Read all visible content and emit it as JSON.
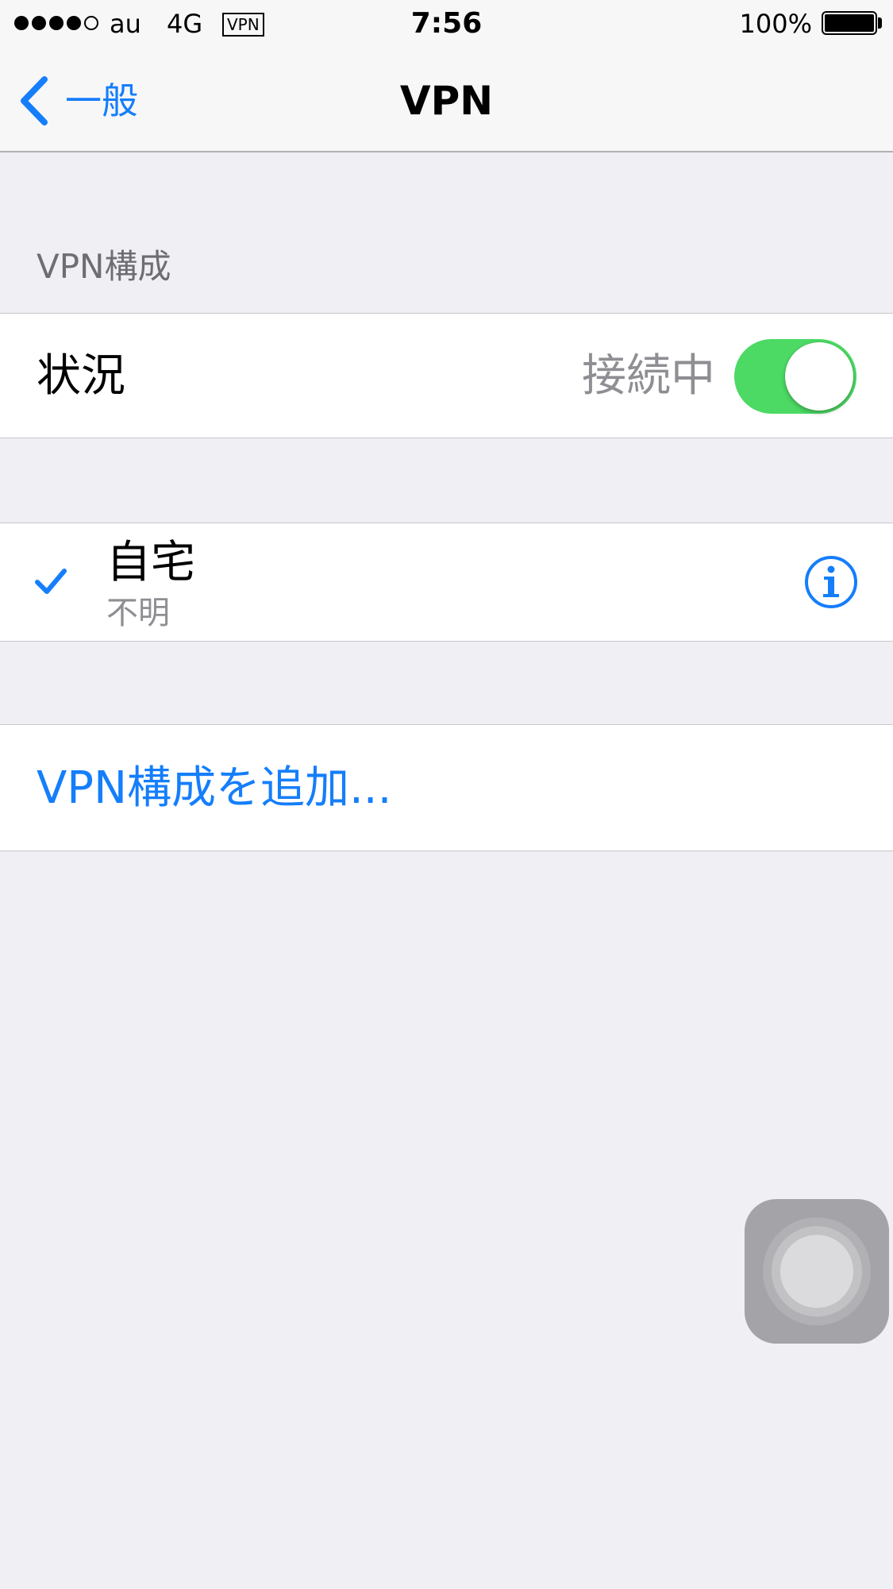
{
  "status_bar": {
    "carrier": "au",
    "network": "4G",
    "vpn_badge": "VPN",
    "time": "7:56",
    "battery_percent": "100%"
  },
  "nav": {
    "back_label": "一般",
    "title": "VPN"
  },
  "section": {
    "header": "VPN構成"
  },
  "status_row": {
    "label": "状況",
    "value": "接続中",
    "toggle_on": true
  },
  "configs": [
    {
      "name": "自宅",
      "subtitle": "不明",
      "selected": true
    }
  ],
  "add_config": {
    "label": "VPN構成を追加..."
  },
  "colors": {
    "accent": "#157efb",
    "toggle_on": "#4cd964",
    "background": "#efeff4",
    "secondary_text": "#8e8e93"
  },
  "icons": {
    "back": "chevron-left-icon",
    "check": "checkmark-icon",
    "info": "info-circle-icon",
    "assistive_touch": "assistive-touch-icon"
  }
}
